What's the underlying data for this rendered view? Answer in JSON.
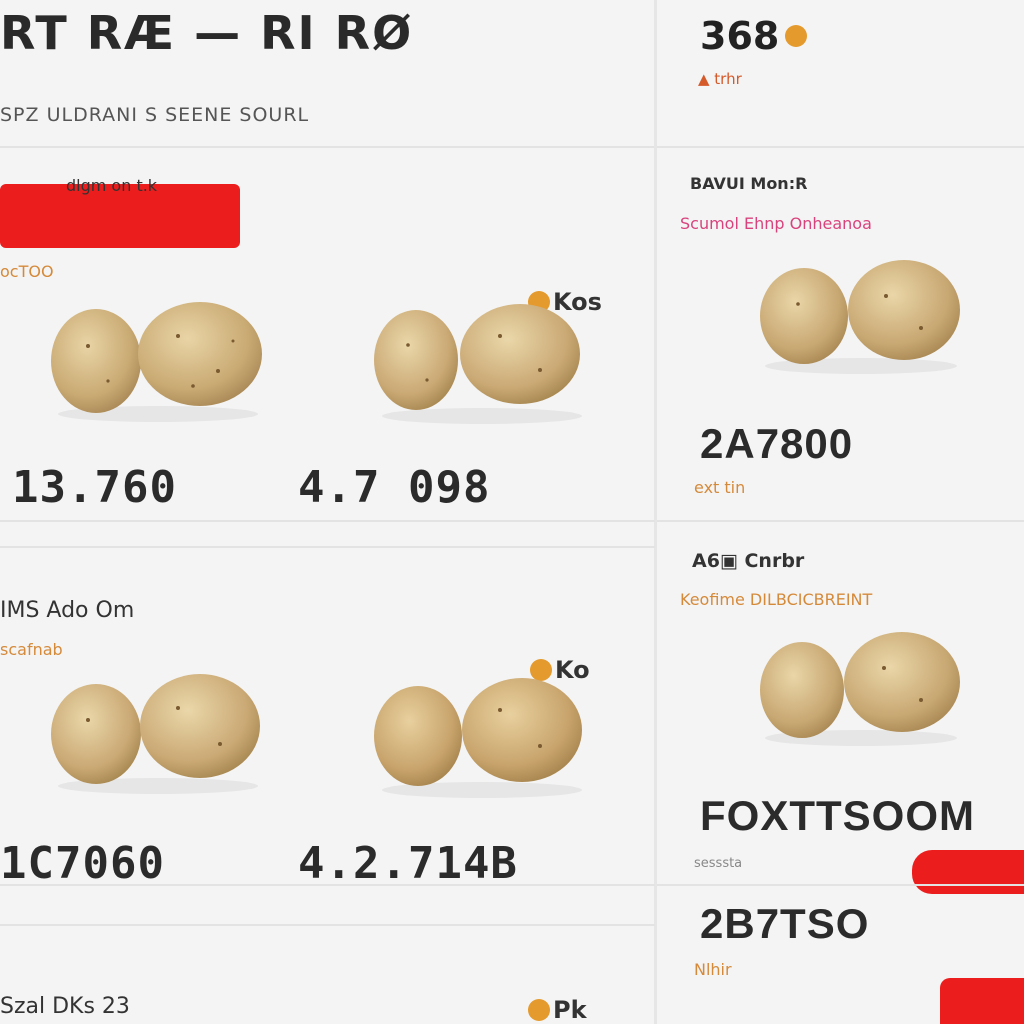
{
  "header": {
    "title": "RT RÆ — RI RØ",
    "subtitle": "SPZ ULDRANI S SEENE SOURL",
    "price_top_right": "368",
    "tag_top_right": "▲ trhr"
  },
  "cards": [
    {
      "label": "dlgm  on t.k",
      "orange": "ocTOO",
      "price": "13.760"
    },
    {
      "label": "",
      "badge": "Kos",
      "price": "4.7 098"
    },
    {
      "label": "BAVUI Mon:R",
      "orange": "Scumol  Ehnp Onheanoa",
      "price": "2A7800",
      "note": "ext tin"
    },
    {
      "label": "IMS  Ado  Om",
      "orange": "scafnab",
      "price": "1C7060"
    },
    {
      "label": "",
      "badge": "Ko",
      "price": "4.2.714B"
    },
    {
      "label": "A6▣ Cnrbr",
      "orange": "Keofime DILBCICBREINT",
      "price": "FOXTTSOOM",
      "note": "sesssta"
    },
    {
      "label": "Szal  DKs  23",
      "badge": "Pk",
      "price_right": "2B7TSO",
      "note": "Nlhir"
    }
  ],
  "colors": {
    "accent_red": "#ec1d1d",
    "accent_orange": "#e49a2d",
    "background": "#f4f4f4"
  },
  "icons": [
    "product-potato-icon",
    "badge-orange-dot-icon"
  ]
}
